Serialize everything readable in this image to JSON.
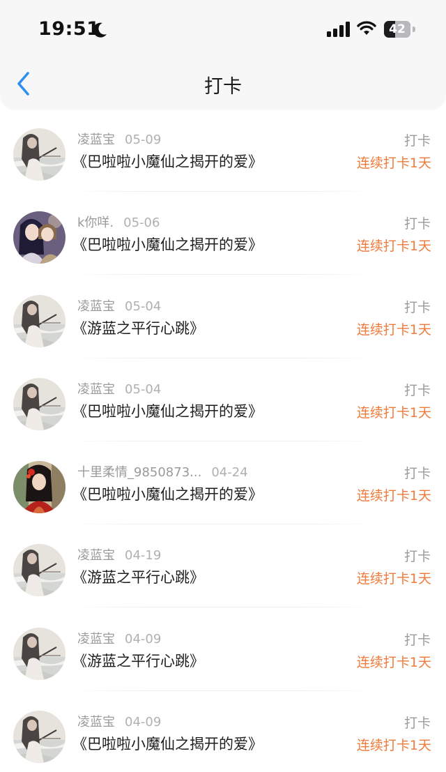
{
  "status_bar": {
    "time": "19:51",
    "battery": "42",
    "battery_level": 0.42
  },
  "header": {
    "title": "打卡"
  },
  "records": [
    {
      "user": "凌蓝宝",
      "date": "05-09",
      "book": "《巴啦啦小魔仙之揭开的爱》",
      "action": "打卡",
      "streak": "连续打卡1天",
      "avatar": "landscape"
    },
    {
      "user": "k你咩.",
      "date": "05-06",
      "book": "《巴啦啦小魔仙之揭开的爱》",
      "action": "打卡",
      "streak": "连续打卡1天",
      "avatar": "couple"
    },
    {
      "user": "凌蓝宝",
      "date": "05-04",
      "book": "《游蓝之平行心跳》",
      "action": "打卡",
      "streak": "连续打卡1天",
      "avatar": "landscape"
    },
    {
      "user": "凌蓝宝",
      "date": "05-04",
      "book": "《巴啦啦小魔仙之揭开的爱》",
      "action": "打卡",
      "streak": "连续打卡1天",
      "avatar": "landscape"
    },
    {
      "user": "十里柔情_9850873...",
      "date": "04-24",
      "book": "《巴啦啦小魔仙之揭开的爱》",
      "action": "打卡",
      "streak": "连续打卡1天",
      "avatar": "red-dress"
    },
    {
      "user": "凌蓝宝",
      "date": "04-19",
      "book": "《游蓝之平行心跳》",
      "action": "打卡",
      "streak": "连续打卡1天",
      "avatar": "landscape"
    },
    {
      "user": "凌蓝宝",
      "date": "04-09",
      "book": "《游蓝之平行心跳》",
      "action": "打卡",
      "streak": "连续打卡1天",
      "avatar": "landscape"
    },
    {
      "user": "凌蓝宝",
      "date": "04-09",
      "book": "《巴啦啦小魔仙之揭开的爱》",
      "action": "打卡",
      "streak": "连续打卡1天",
      "avatar": "landscape"
    }
  ],
  "colors": {
    "accent": "#2e8ff0",
    "streak": "#f07a3a",
    "muted": "#9a9a9a"
  },
  "icons": {
    "back": "chevron-left-icon",
    "moon": "moon-icon",
    "signal": "signal-icon",
    "wifi": "wifi-icon",
    "battery": "battery-icon"
  }
}
